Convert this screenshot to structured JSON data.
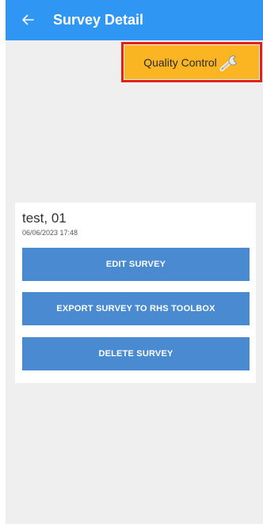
{
  "header": {
    "title": "Survey Detail",
    "back_icon": "arrow-left-icon",
    "background": "#2f96f3"
  },
  "quality_control": {
    "label": "Quality Control",
    "icon": "wrench-icon",
    "background": "#fbb523",
    "highlight_border": "#e2231a"
  },
  "survey": {
    "name": "test, 01",
    "date": "06/06/2023 17:48"
  },
  "actions": {
    "edit_label": "EDIT SURVEY",
    "export_label": "EXPORT SURVEY TO RHS TOOLBOX",
    "delete_label": "DELETE SURVEY",
    "background": "#4a8ad1"
  }
}
